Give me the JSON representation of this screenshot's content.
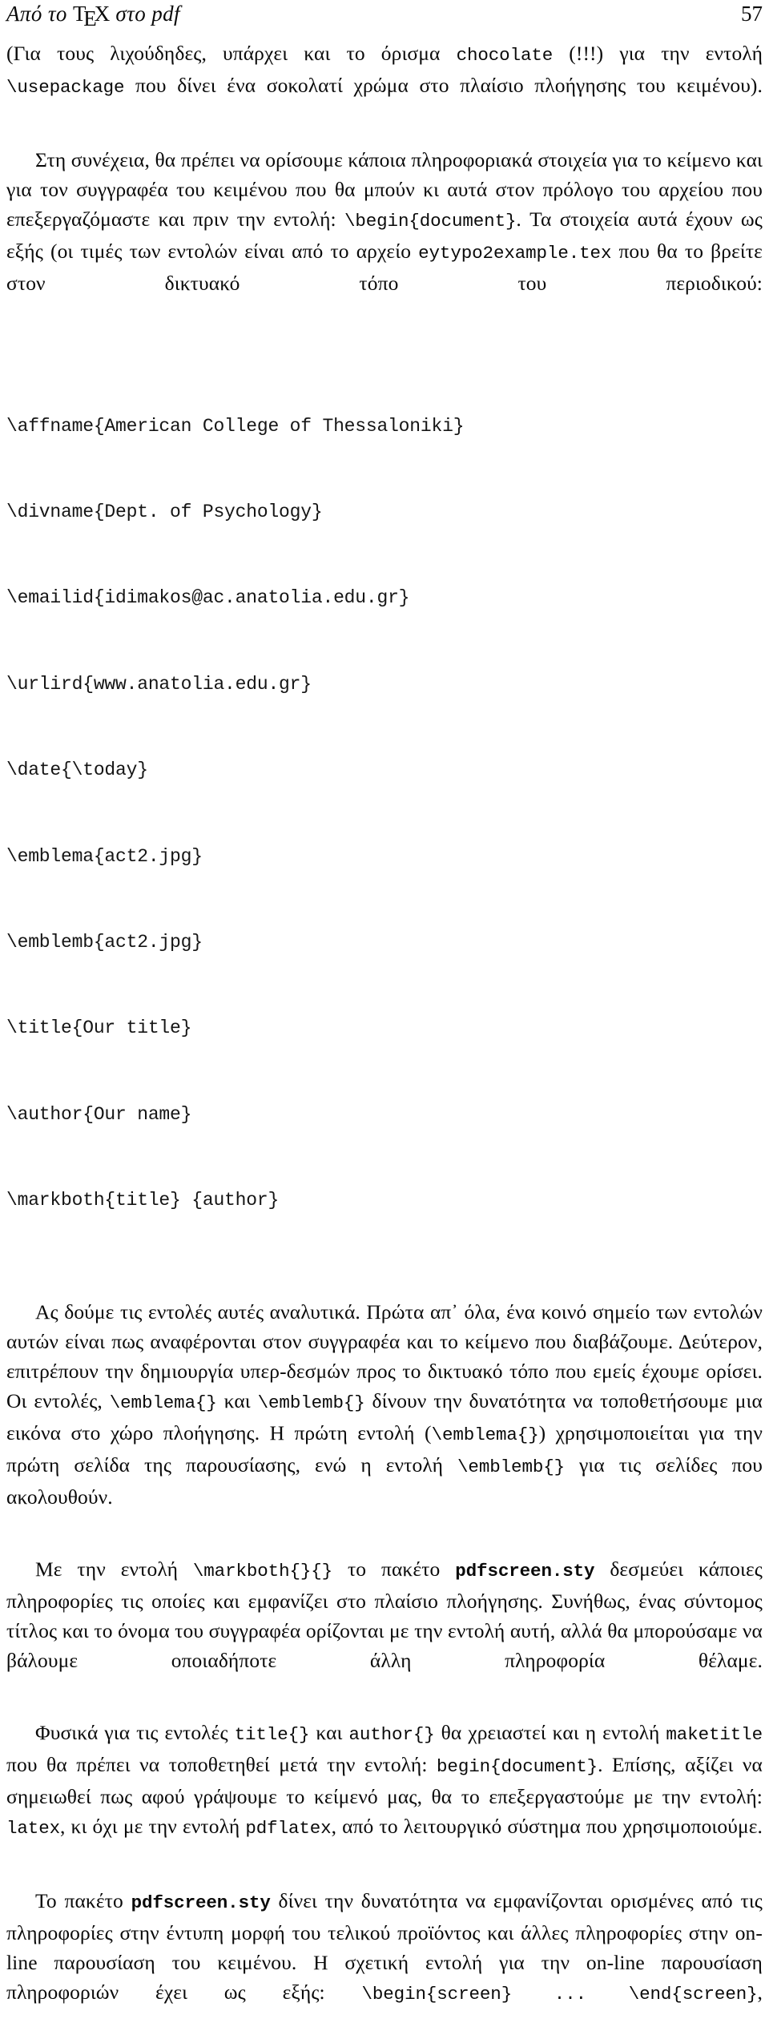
{
  "header": {
    "title_prefix": "Από το ",
    "tex_t": "T",
    "tex_e": "E",
    "tex_x": "X",
    "title_suffix": " στο pdf",
    "page_number": "57"
  },
  "paragraphs": {
    "p1": {
      "seg1": "(Για τους λιχούδηδες, υπάρχει και το όρισμα ",
      "code1": "chocolate",
      "seg2": " (!!!) για την εντολή ",
      "code2": "\\usepackage",
      "seg3": " που δίνει ένα σοκολατί χρώμα στο πλαίσιο πλοήγησης του κειμένου)."
    },
    "p2": {
      "seg1": "Στη συνέχεια, θα πρέπει να ορίσουμε κάποια πληροφοριακά στοιχεία για το κείμενο και για τον συγγραφέα του κειμένου που θα μπούν κι αυτά στον πρόλογο του αρχείου που επεξεργαζόμαστε και πριν την εντολή: ",
      "code1": "\\begin{document}",
      "seg2": ". Τα στοιχεία αυτά έχουν ως εξής (οι τιμές των εντολών είναι από το αρχείο ",
      "code2": "eytypo2example.tex",
      "seg3": " που θα το βρείτε στον δικτυακό τόπο του περιοδικού:"
    },
    "p3": {
      "seg1": "Ας δούμε τις εντολές αυτές αναλυτικά. Πρώτα απ᾿ όλα, ένα κοινό σημείο των εντολών αυτών είναι πως αναφέρονται στον συγγραφέα και το κείμενο που διαβάζουμε. Δεύτερον, επιτρέπουν την δημιουργία υπερ-δεσμών προς το δικτυακό τόπο που εμείς έχουμε ορίσει. Οι εντολές, ",
      "code1": "\\emblema{}",
      "seg2": " και ",
      "code2": "\\emblemb{}",
      "seg3": " δίνουν την δυνατότητα να τοποθετήσουμε μια εικόνα στο χώρο πλοήγησης. Η πρώτη εντολή (",
      "code3": "\\emblema{}",
      "seg4": ") χρησιμοποιείται για την πρώτη σελίδα της παρουσίασης, ενώ η εντολή ",
      "code4": "\\emblemb{}",
      "seg5": " για τις σελίδες που ακολουθούν."
    },
    "p4": {
      "seg1": "Με την εντολή ",
      "code1": "\\markboth{}{}",
      "seg2": " το πακέτο ",
      "code2": "pdfscreen.sty",
      "seg3": " δεσμεύει κάποιες πληροφορίες τις οποίες και εμφανίζει στο πλαίσιο πλοήγησης. Συνήθως, ένας σύντομος τίτλος και το όνομα του συγγραφέα ορίζονται με την εντολή αυτή, αλλά θα μπορούσαμε να βάλουμε οποιαδήποτε άλλη πληροφορία θέλαμε."
    },
    "p5": {
      "seg1": "Φυσικά για τις εντολές ",
      "code1": "title{}",
      "seg2": " και ",
      "code2": "author{}",
      "seg3": " θα χρειαστεί και η εντολή ",
      "code3": "maketitle",
      "seg4": " που θα πρέπει να τοποθετηθεί μετά την εντολή: ",
      "code4": "begin{document}",
      "seg5": ". Επίσης, αξίζει να σημειωθεί πως αφού γράψουμε το κείμενό μας, θα το επεξεργαστούμε με την εντολή: ",
      "code5": "latex",
      "seg6": ", κι όχι με την εντολή ",
      "code6": "pdflatex",
      "seg7": ", από το λειτουργικό σύστημα που χρησιμοποιούμε."
    },
    "p6": {
      "seg1": "Το πακέτο ",
      "code1": "pdfscreen.sty",
      "seg2": " δίνει την δυνατότητα να εμφανίζονται ορισμένες από τις πληροφορίες στην έντυπη μορφή του τελικού προϊόντος και άλλες πληροφορίες στην on-line παρουσίαση του κειμένου. Η σχετική εντολή για την on-line παρουσίαση πληροφοριών έχει ως εξής: ",
      "code2": "\\begin{screen}",
      "seg3": "   ",
      "code3": "...",
      "seg4": "   ",
      "code4": "\\end{screen}",
      "seg5": ","
    }
  },
  "code_block": {
    "lines": [
      "\\affname{American College of Thessaloniki}",
      "\\divname{Dept. of Psychology}",
      "\\emailid{idimakos@ac.anatolia.edu.gr}",
      "\\urlird{www.anatolia.edu.gr}",
      "\\date{\\today}",
      "\\emblema{act2.jpg}",
      "\\emblemb{act2.jpg}",
      "\\title{Our title}",
      "\\author{Our name}",
      "\\markboth{title} {author}"
    ]
  }
}
